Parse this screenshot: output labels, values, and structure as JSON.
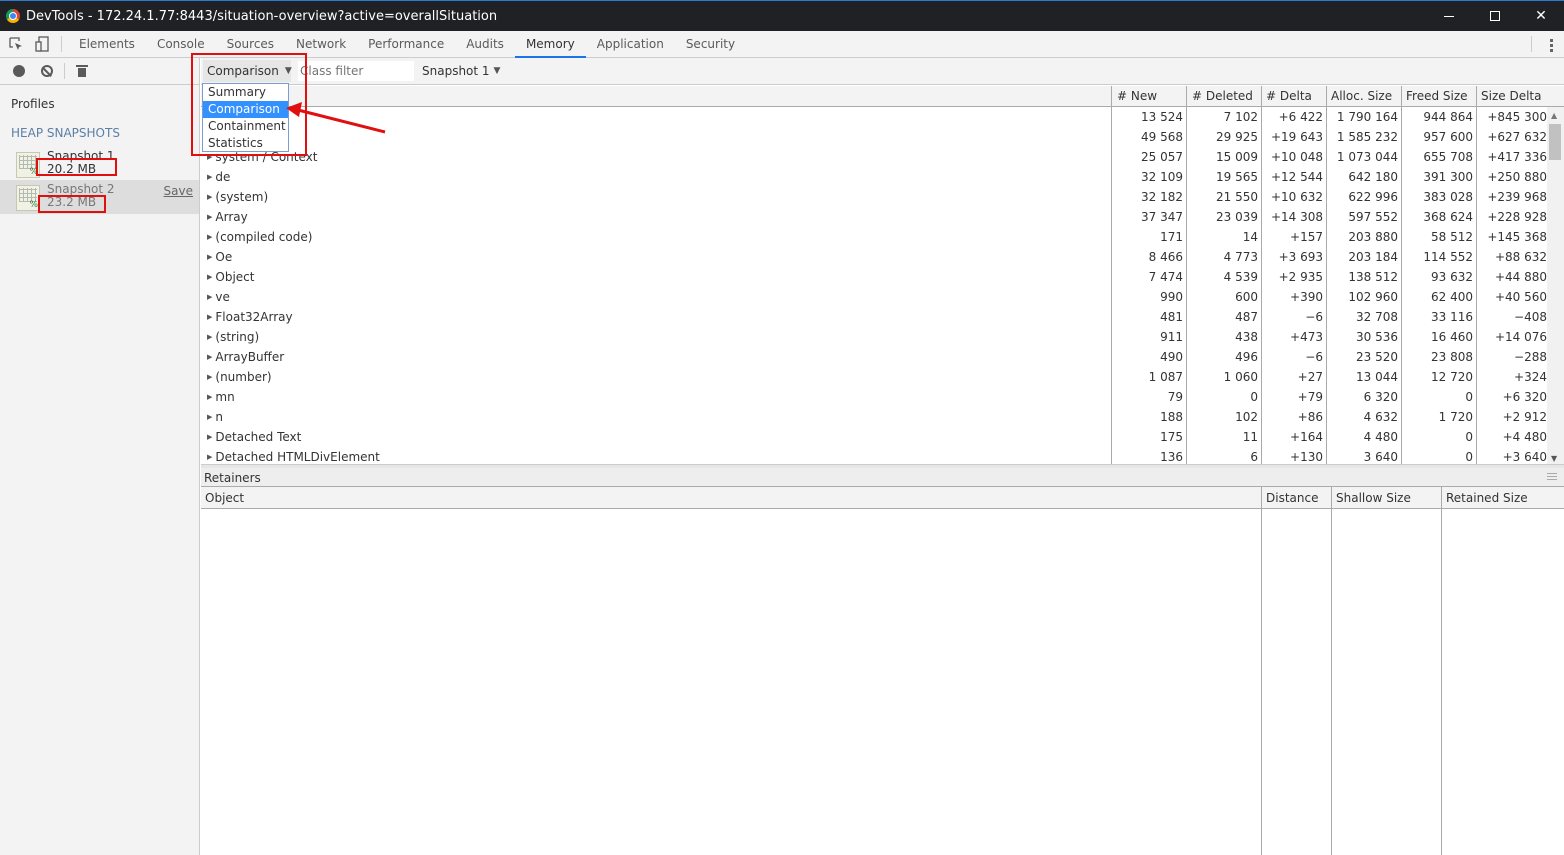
{
  "window": {
    "title": "DevTools - 172.24.1.77:8443/situation-overview?active=overallSituation"
  },
  "tabs": [
    {
      "label": "Elements"
    },
    {
      "label": "Console"
    },
    {
      "label": "Sources"
    },
    {
      "label": "Network"
    },
    {
      "label": "Performance"
    },
    {
      "label": "Audits"
    },
    {
      "label": "Memory",
      "active": true
    },
    {
      "label": "Application"
    },
    {
      "label": "Security"
    }
  ],
  "sidebar": {
    "profiles_label": "Profiles",
    "section_label": "HEAP SNAPSHOTS",
    "snapshots": [
      {
        "name": "Snapshot 1",
        "size": "20.2 MB"
      },
      {
        "name": "Snapshot 2",
        "size": "23.2 MB",
        "action": "Save"
      }
    ]
  },
  "toolbar": {
    "view_selected": "Comparison",
    "class_filter_placeholder": "Class filter",
    "base_snapshot": "Snapshot 1"
  },
  "view_dropdown": {
    "options": [
      "Summary",
      "Comparison",
      "Containment",
      "Statistics"
    ],
    "selected": "Comparison"
  },
  "grid": {
    "columns": [
      "# New",
      "# Deleted",
      "# Delta",
      "Alloc. Size",
      "Freed Size",
      "Size Delta"
    ],
    "rows": [
      {
        "name": "",
        "new": "13 524",
        "deleted": "7 102",
        "delta": "+6 422",
        "alloc": "1 790 164",
        "freed": "944 864",
        "size_delta": "+845 300"
      },
      {
        "name": "",
        "new": "49 568",
        "deleted": "29 925",
        "delta": "+19 643",
        "alloc": "1 585 232",
        "freed": "957 600",
        "size_delta": "+627 632"
      },
      {
        "name": "system / Context",
        "new": "25 057",
        "deleted": "15 009",
        "delta": "+10 048",
        "alloc": "1 073 044",
        "freed": "655 708",
        "size_delta": "+417 336"
      },
      {
        "name": "de",
        "new": "32 109",
        "deleted": "19 565",
        "delta": "+12 544",
        "alloc": "642 180",
        "freed": "391 300",
        "size_delta": "+250 880"
      },
      {
        "name": "(system)",
        "new": "32 182",
        "deleted": "21 550",
        "delta": "+10 632",
        "alloc": "622 996",
        "freed": "383 028",
        "size_delta": "+239 968"
      },
      {
        "name": "Array",
        "new": "37 347",
        "deleted": "23 039",
        "delta": "+14 308",
        "alloc": "597 552",
        "freed": "368 624",
        "size_delta": "+228 928"
      },
      {
        "name": "(compiled code)",
        "new": "171",
        "deleted": "14",
        "delta": "+157",
        "alloc": "203 880",
        "freed": "58 512",
        "size_delta": "+145 368"
      },
      {
        "name": "Oe",
        "new": "8 466",
        "deleted": "4 773",
        "delta": "+3 693",
        "alloc": "203 184",
        "freed": "114 552",
        "size_delta": "+88 632"
      },
      {
        "name": "Object",
        "new": "7 474",
        "deleted": "4 539",
        "delta": "+2 935",
        "alloc": "138 512",
        "freed": "93 632",
        "size_delta": "+44 880"
      },
      {
        "name": "ve",
        "new": "990",
        "deleted": "600",
        "delta": "+390",
        "alloc": "102 960",
        "freed": "62 400",
        "size_delta": "+40 560"
      },
      {
        "name": "Float32Array",
        "new": "481",
        "deleted": "487",
        "delta": "−6",
        "alloc": "32 708",
        "freed": "33 116",
        "size_delta": "−408"
      },
      {
        "name": "(string)",
        "new": "911",
        "deleted": "438",
        "delta": "+473",
        "alloc": "30 536",
        "freed": "16 460",
        "size_delta": "+14 076"
      },
      {
        "name": "ArrayBuffer",
        "new": "490",
        "deleted": "496",
        "delta": "−6",
        "alloc": "23 520",
        "freed": "23 808",
        "size_delta": "−288"
      },
      {
        "name": "(number)",
        "new": "1 087",
        "deleted": "1 060",
        "delta": "+27",
        "alloc": "13 044",
        "freed": "12 720",
        "size_delta": "+324"
      },
      {
        "name": "mn",
        "new": "79",
        "deleted": "0",
        "delta": "+79",
        "alloc": "6 320",
        "freed": "0",
        "size_delta": "+6 320"
      },
      {
        "name": "n",
        "new": "188",
        "deleted": "102",
        "delta": "+86",
        "alloc": "4 632",
        "freed": "1 720",
        "size_delta": "+2 912"
      },
      {
        "name": "Detached Text",
        "new": "175",
        "deleted": "11",
        "delta": "+164",
        "alloc": "4 480",
        "freed": "0",
        "size_delta": "+4 480"
      },
      {
        "name": "Detached HTMLDivElement",
        "new": "136",
        "deleted": "6",
        "delta": "+130",
        "alloc": "3 640",
        "freed": "0",
        "size_delta": "+3 640"
      }
    ]
  },
  "retainers": {
    "title": "Retainers",
    "columns": [
      "Object",
      "Distance",
      "Shallow Size",
      "Retained Size"
    ]
  },
  "colors": {
    "accent": "#1a73e8",
    "selected_option": "#3390ff",
    "annotation": "#e01010"
  }
}
